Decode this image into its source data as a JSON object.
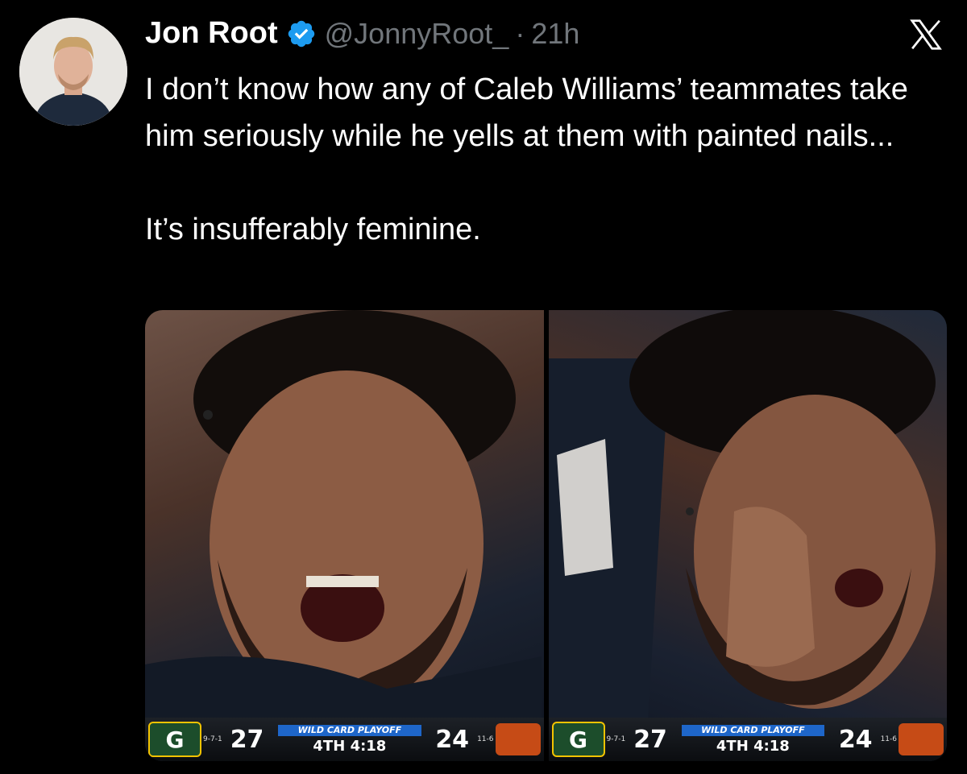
{
  "author": {
    "name": "Jon Root",
    "handle": "@JonnyRoot_",
    "separator": "·",
    "time": "21h",
    "verified_color": "#1d9bf0"
  },
  "tweet": {
    "line1": "I don’t know how any of Caleb Williams’ teammates take him seriously while he yells at them with painted nails...",
    "line2": "It’s insufferably feminine."
  },
  "platform_icon": "x-logo",
  "media": [
    {
      "scorebug": {
        "home_score": "27",
        "home_record": "9-7-1",
        "banner": "WILD CARD PLAYOFF",
        "quarter": "4TH",
        "clock": "4:18",
        "away_score": "24",
        "away_record": "11-6"
      }
    },
    {
      "scorebug": {
        "home_score": "27",
        "home_record": "9-7-1",
        "banner": "WILD CARD PLAYOFF",
        "quarter": "4TH",
        "clock": "4:18",
        "away_score": "24",
        "away_record": "11-6"
      }
    }
  ],
  "colors": {
    "background": "#000000",
    "text": "#ffffff",
    "secondary": "#71767b"
  }
}
